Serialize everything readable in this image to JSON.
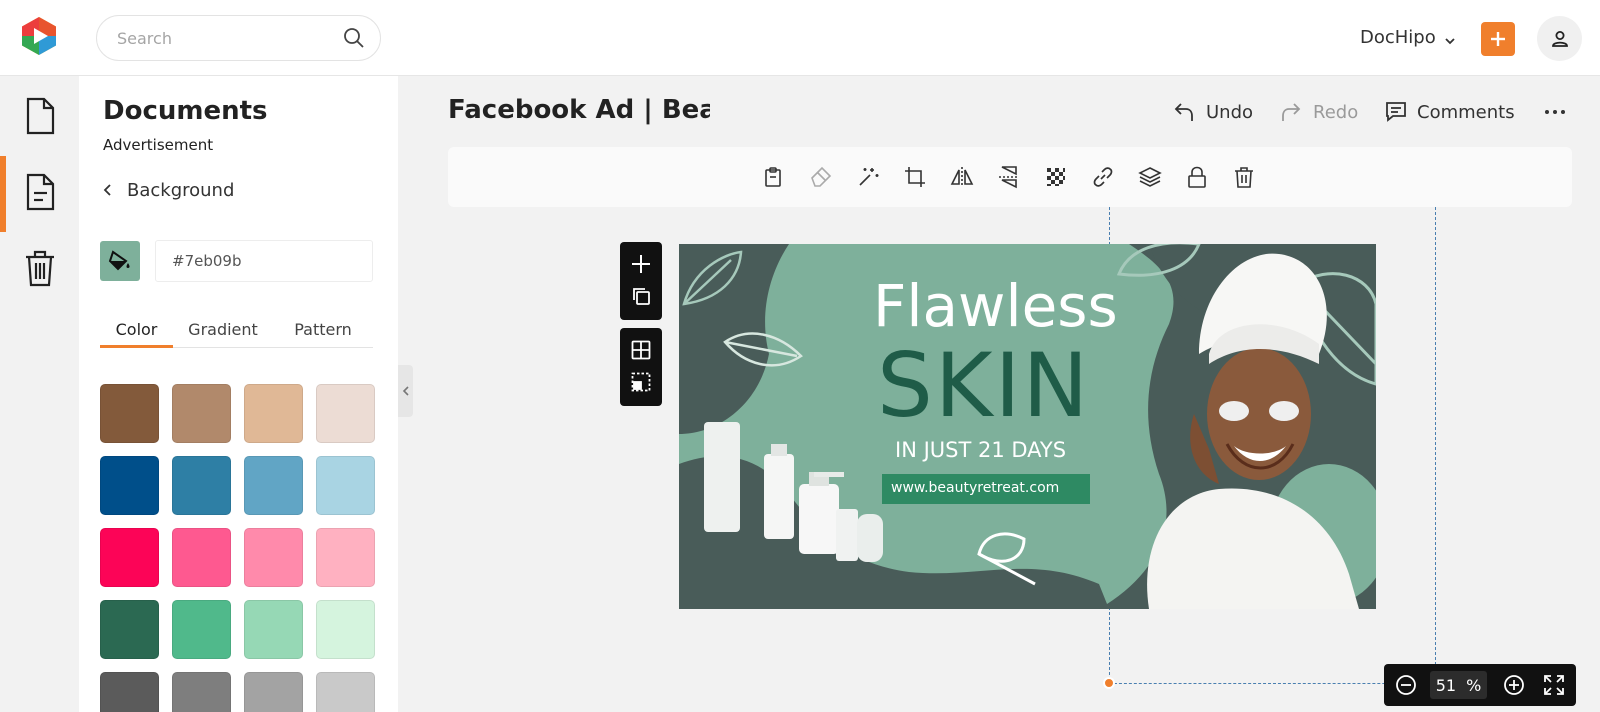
{
  "header": {
    "search": {
      "placeholder": "Search",
      "value": ""
    },
    "account_label": "DocHipo"
  },
  "rail": {
    "items": [
      {
        "icon": "document-icon",
        "active": false
      },
      {
        "icon": "documents-list-icon",
        "active": true
      },
      {
        "icon": "trash-icon",
        "active": false
      }
    ]
  },
  "panel": {
    "title": "Documents",
    "subtitle": "Advertisement",
    "back_label": "Background",
    "color_value": "#7eb09b",
    "tabs": [
      {
        "label": "Color",
        "active": true
      },
      {
        "label": "Gradient",
        "active": false
      },
      {
        "label": "Pattern",
        "active": false
      }
    ],
    "swatches": [
      "#835a3b",
      "#b1896b",
      "#e0b896",
      "#ecdcd4",
      "#004f8a",
      "#2e7fa5",
      "#61a5c5",
      "#a9d4e3",
      "#fc0457",
      "#fe5990",
      "#ff8aab",
      "#ffb1c1",
      "#2b6952",
      "#50b98b",
      "#96d8b5",
      "#d5f4de",
      "#5b5b5b",
      "#7e7e7e",
      "#a3a3a3",
      "#c9c9c9"
    ]
  },
  "document": {
    "title": "Facebook Ad | Beauty Retreat",
    "actions": {
      "undo": "Undo",
      "redo": "Redo",
      "comments": "Comments"
    }
  },
  "toolbar": {
    "tools": [
      "clipboard-icon",
      "eraser-icon",
      "magic-wand-icon",
      "crop-icon",
      "flip-horizontal-icon",
      "flip-vertical-icon",
      "transparency-icon",
      "link-icon",
      "layers-icon",
      "lock-icon",
      "delete-icon"
    ]
  },
  "design": {
    "headline_1": "Flawless",
    "headline_2": "SKIN",
    "tagline": "IN JUST 21 DAYS",
    "url": "www.beautyretreat.com",
    "colors": {
      "background": "#7eb09b",
      "dark": "#495c59",
      "text_dark": "#1f5c48",
      "button": "#2e8a63"
    }
  },
  "zoom": {
    "value": "51",
    "unit": "%"
  },
  "colors": {
    "accent": "#f07f2c"
  }
}
